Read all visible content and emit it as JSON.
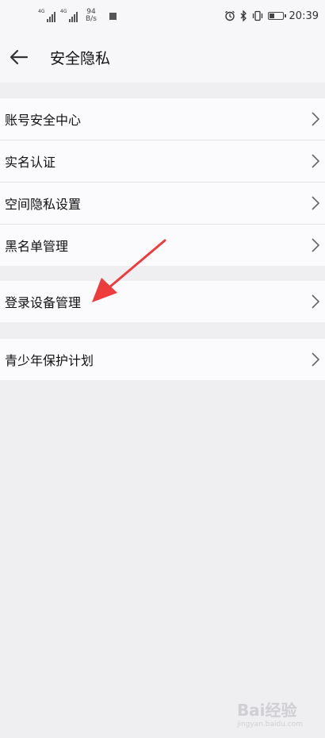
{
  "statusbar": {
    "net_left": "4G",
    "net_right": "4G",
    "speed_value": "94",
    "speed_unit": "B/s",
    "time": "20:39"
  },
  "header": {
    "title": "安全隐私"
  },
  "groups": [
    {
      "items": [
        "账号安全中心",
        "实名认证",
        "空间隐私设置",
        "黑名单管理"
      ]
    },
    {
      "items": [
        "登录设备管理"
      ]
    },
    {
      "items": [
        "青少年保护计划"
      ]
    }
  ],
  "watermark": {
    "text": "Bai经验",
    "sub": "jingyan.baidu.com"
  },
  "colors": {
    "background": "#efeef1",
    "surface": "#fbfbfd",
    "annotation_arrow": "#ee3b3b"
  }
}
